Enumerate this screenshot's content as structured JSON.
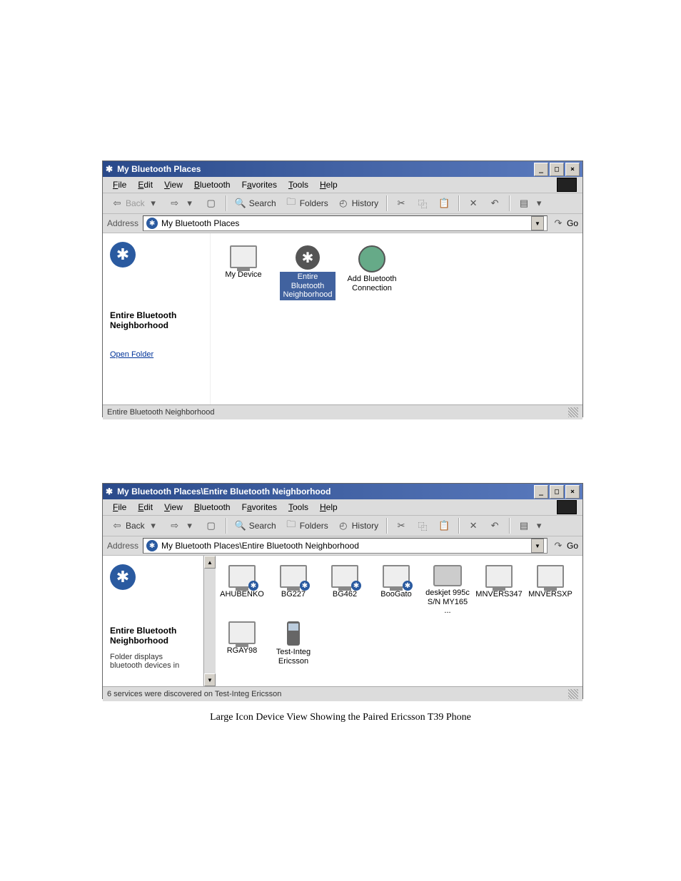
{
  "caption": "Large Icon Device View Showing the Paired Ericsson T39 Phone",
  "win1": {
    "title": "My Bluetooth Places",
    "menus": [
      "File",
      "Edit",
      "View",
      "Bluetooth",
      "Favorites",
      "Tools",
      "Help"
    ],
    "toolbar": {
      "back": "Back",
      "search": "Search",
      "folders": "Folders",
      "history": "History"
    },
    "address_label": "Address",
    "address_value": "My Bluetooth Places",
    "go": "Go",
    "left": {
      "heading": "Entire Bluetooth Neighborhood",
      "link": "Open Folder"
    },
    "items": [
      {
        "label": "My Device",
        "type": "mon",
        "selected": false
      },
      {
        "label": "Entire Bluetooth Neighborhood",
        "type": "bt",
        "selected": true
      },
      {
        "label": "Add Bluetooth Connection",
        "type": "globe",
        "selected": false
      }
    ],
    "status": "Entire Bluetooth Neighborhood"
  },
  "win2": {
    "title": "My Bluetooth Places\\Entire Bluetooth Neighborhood",
    "menus": [
      "File",
      "Edit",
      "View",
      "Bluetooth",
      "Favorites",
      "Tools",
      "Help"
    ],
    "toolbar": {
      "back": "Back",
      "search": "Search",
      "folders": "Folders",
      "history": "History"
    },
    "address_label": "Address",
    "address_value": "My Bluetooth Places\\Entire Bluetooth Neighborhood",
    "go": "Go",
    "left": {
      "heading": "Entire Bluetooth Neighborhood",
      "desc": "Folder displays bluetooth devices in"
    },
    "items": [
      {
        "label": "AHUBENKO",
        "type": "monbt"
      },
      {
        "label": "BG227",
        "type": "monbt"
      },
      {
        "label": "BG462",
        "type": "monbt"
      },
      {
        "label": "BooGato",
        "type": "monbt"
      },
      {
        "label": "deskjet 995c S/N MY165 ...",
        "type": "prn"
      },
      {
        "label": "MNVERS347",
        "type": "mon"
      },
      {
        "label": "MNVERSXP",
        "type": "mon"
      },
      {
        "label": "RGAY98",
        "type": "mon"
      },
      {
        "label": "Test-Integ Ericsson",
        "type": "phone"
      }
    ],
    "status": "6 services were discovered on Test-Integ Ericsson"
  }
}
